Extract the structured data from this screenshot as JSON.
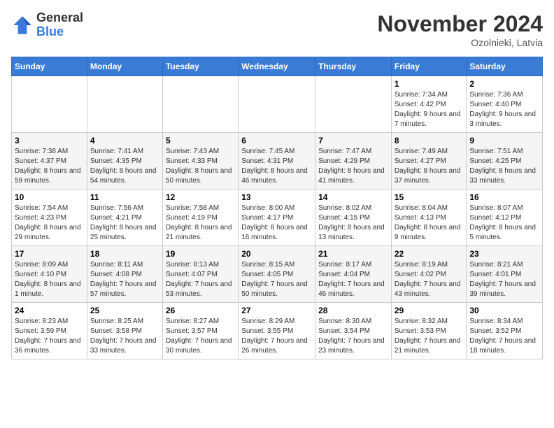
{
  "header": {
    "logo": {
      "general": "General",
      "blue": "Blue"
    },
    "title": "November 2024",
    "location": "Ozolnieki, Latvia"
  },
  "days_of_week": [
    "Sunday",
    "Monday",
    "Tuesday",
    "Wednesday",
    "Thursday",
    "Friday",
    "Saturday"
  ],
  "weeks": [
    [
      null,
      null,
      null,
      null,
      null,
      {
        "day": "1",
        "sunrise": "Sunrise: 7:34 AM",
        "sunset": "Sunset: 4:42 PM",
        "daylight": "Daylight: 9 hours and 7 minutes."
      },
      {
        "day": "2",
        "sunrise": "Sunrise: 7:36 AM",
        "sunset": "Sunset: 4:40 PM",
        "daylight": "Daylight: 9 hours and 3 minutes."
      }
    ],
    [
      {
        "day": "3",
        "sunrise": "Sunrise: 7:38 AM",
        "sunset": "Sunset: 4:37 PM",
        "daylight": "Daylight: 8 hours and 59 minutes."
      },
      {
        "day": "4",
        "sunrise": "Sunrise: 7:41 AM",
        "sunset": "Sunset: 4:35 PM",
        "daylight": "Daylight: 8 hours and 54 minutes."
      },
      {
        "day": "5",
        "sunrise": "Sunrise: 7:43 AM",
        "sunset": "Sunset: 4:33 PM",
        "daylight": "Daylight: 8 hours and 50 minutes."
      },
      {
        "day": "6",
        "sunrise": "Sunrise: 7:45 AM",
        "sunset": "Sunset: 4:31 PM",
        "daylight": "Daylight: 8 hours and 46 minutes."
      },
      {
        "day": "7",
        "sunrise": "Sunrise: 7:47 AM",
        "sunset": "Sunset: 4:29 PM",
        "daylight": "Daylight: 8 hours and 41 minutes."
      },
      {
        "day": "8",
        "sunrise": "Sunrise: 7:49 AM",
        "sunset": "Sunset: 4:27 PM",
        "daylight": "Daylight: 8 hours and 37 minutes."
      },
      {
        "day": "9",
        "sunrise": "Sunrise: 7:51 AM",
        "sunset": "Sunset: 4:25 PM",
        "daylight": "Daylight: 8 hours and 33 minutes."
      }
    ],
    [
      {
        "day": "10",
        "sunrise": "Sunrise: 7:54 AM",
        "sunset": "Sunset: 4:23 PM",
        "daylight": "Daylight: 8 hours and 29 minutes."
      },
      {
        "day": "11",
        "sunrise": "Sunrise: 7:56 AM",
        "sunset": "Sunset: 4:21 PM",
        "daylight": "Daylight: 8 hours and 25 minutes."
      },
      {
        "day": "12",
        "sunrise": "Sunrise: 7:58 AM",
        "sunset": "Sunset: 4:19 PM",
        "daylight": "Daylight: 8 hours and 21 minutes."
      },
      {
        "day": "13",
        "sunrise": "Sunrise: 8:00 AM",
        "sunset": "Sunset: 4:17 PM",
        "daylight": "Daylight: 8 hours and 16 minutes."
      },
      {
        "day": "14",
        "sunrise": "Sunrise: 8:02 AM",
        "sunset": "Sunset: 4:15 PM",
        "daylight": "Daylight: 8 hours and 13 minutes."
      },
      {
        "day": "15",
        "sunrise": "Sunrise: 8:04 AM",
        "sunset": "Sunset: 4:13 PM",
        "daylight": "Daylight: 8 hours and 9 minutes."
      },
      {
        "day": "16",
        "sunrise": "Sunrise: 8:07 AM",
        "sunset": "Sunset: 4:12 PM",
        "daylight": "Daylight: 8 hours and 5 minutes."
      }
    ],
    [
      {
        "day": "17",
        "sunrise": "Sunrise: 8:09 AM",
        "sunset": "Sunset: 4:10 PM",
        "daylight": "Daylight: 8 hours and 1 minute."
      },
      {
        "day": "18",
        "sunrise": "Sunrise: 8:11 AM",
        "sunset": "Sunset: 4:08 PM",
        "daylight": "Daylight: 7 hours and 57 minutes."
      },
      {
        "day": "19",
        "sunrise": "Sunrise: 8:13 AM",
        "sunset": "Sunset: 4:07 PM",
        "daylight": "Daylight: 7 hours and 53 minutes."
      },
      {
        "day": "20",
        "sunrise": "Sunrise: 8:15 AM",
        "sunset": "Sunset: 4:05 PM",
        "daylight": "Daylight: 7 hours and 50 minutes."
      },
      {
        "day": "21",
        "sunrise": "Sunrise: 8:17 AM",
        "sunset": "Sunset: 4:04 PM",
        "daylight": "Daylight: 7 hours and 46 minutes."
      },
      {
        "day": "22",
        "sunrise": "Sunrise: 8:19 AM",
        "sunset": "Sunset: 4:02 PM",
        "daylight": "Daylight: 7 hours and 43 minutes."
      },
      {
        "day": "23",
        "sunrise": "Sunrise: 8:21 AM",
        "sunset": "Sunset: 4:01 PM",
        "daylight": "Daylight: 7 hours and 39 minutes."
      }
    ],
    [
      {
        "day": "24",
        "sunrise": "Sunrise: 8:23 AM",
        "sunset": "Sunset: 3:59 PM",
        "daylight": "Daylight: 7 hours and 36 minutes."
      },
      {
        "day": "25",
        "sunrise": "Sunrise: 8:25 AM",
        "sunset": "Sunset: 3:58 PM",
        "daylight": "Daylight: 7 hours and 33 minutes."
      },
      {
        "day": "26",
        "sunrise": "Sunrise: 8:27 AM",
        "sunset": "Sunset: 3:57 PM",
        "daylight": "Daylight: 7 hours and 30 minutes."
      },
      {
        "day": "27",
        "sunrise": "Sunrise: 8:29 AM",
        "sunset": "Sunset: 3:55 PM",
        "daylight": "Daylight: 7 hours and 26 minutes."
      },
      {
        "day": "28",
        "sunrise": "Sunrise: 8:30 AM",
        "sunset": "Sunset: 3:54 PM",
        "daylight": "Daylight: 7 hours and 23 minutes."
      },
      {
        "day": "29",
        "sunrise": "Sunrise: 8:32 AM",
        "sunset": "Sunset: 3:53 PM",
        "daylight": "Daylight: 7 hours and 21 minutes."
      },
      {
        "day": "30",
        "sunrise": "Sunrise: 8:34 AM",
        "sunset": "Sunset: 3:52 PM",
        "daylight": "Daylight: 7 hours and 18 minutes."
      }
    ]
  ]
}
